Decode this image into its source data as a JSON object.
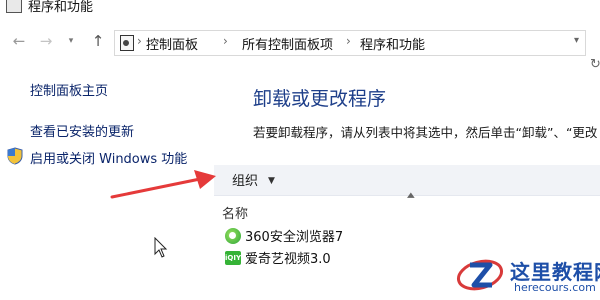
{
  "window": {
    "title": "程序和功能"
  },
  "nav": {
    "back_icon": "arrow-left-icon",
    "forward_icon": "arrow-right-icon",
    "recent_icon": "chevron-down-icon",
    "up_icon": "arrow-up-icon",
    "refresh_icon": "refresh-icon"
  },
  "breadcrumb": {
    "items": [
      "控制面板",
      "所有控制面板项",
      "程序和功能"
    ],
    "separator": "›",
    "dropdown_icon": "chevron-down-icon"
  },
  "sidebar": {
    "home": "控制面板主页",
    "updates": "查看已安装的更新",
    "features": "启用或关闭 Windows 功能",
    "features_icon": "shield-icon"
  },
  "main": {
    "title": "卸载或更改程序",
    "description": "若要卸载程序，请从列表中将其选中，然后单击“卸载”、“更改"
  },
  "toolbar": {
    "organize": "组织",
    "organize_caret": "▼"
  },
  "list": {
    "column_name": "名称",
    "items": [
      {
        "name": "360安全浏览器7",
        "icon": "360-browser-icon"
      },
      {
        "name": "爱奇艺视频3.0",
        "icon": "iqiyi-icon",
        "icon_text": "iQIYI"
      }
    ]
  },
  "watermark": {
    "title": "这里教程网",
    "url": "herecours.com"
  },
  "colors": {
    "link": "#0a246a",
    "heading": "#1e3f8a",
    "annotation_arrow": "#e53a3a",
    "watermark": "#1e4fa8"
  }
}
